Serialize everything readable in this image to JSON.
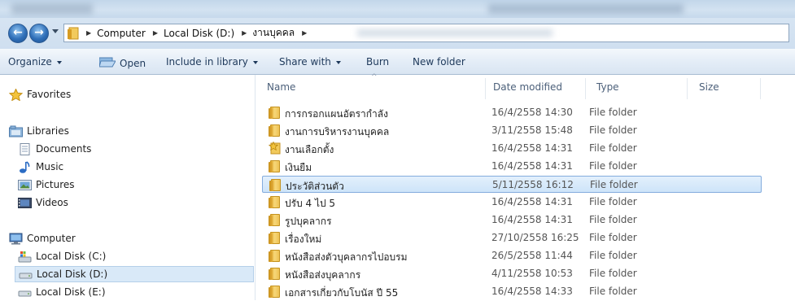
{
  "window": {
    "title": ""
  },
  "address": {
    "back_glyph": "←",
    "forward_glyph": "→",
    "separator": "▶",
    "segments": [
      "Computer",
      "Local Disk (D:)",
      "งานบุคคล"
    ]
  },
  "toolbar": {
    "organize": "Organize",
    "open": "Open",
    "include_in_library": "Include in library",
    "share_with": "Share with",
    "burn": "Burn",
    "new_folder": "New folder"
  },
  "nav": {
    "favorites": "Favorites",
    "libraries": "Libraries",
    "documents": "Documents",
    "music": "Music",
    "pictures": "Pictures",
    "videos": "Videos",
    "computer": "Computer",
    "disk_c": "Local Disk (C:)",
    "disk_d": "Local Disk (D:)",
    "disk_e": "Local Disk (E:)"
  },
  "columns": {
    "name": "Name",
    "date": "Date modified",
    "type": "Type",
    "size": "Size",
    "sort_indicator": "^"
  },
  "files": [
    {
      "name": "การกรอกแผนอัตรากำลัง",
      "date": "16/4/2558 14:30",
      "type": "File folder",
      "icon": "folder-icon"
    },
    {
      "name": "งานการบริหารงานบุคคล",
      "date": "3/11/2558 15:48",
      "type": "File folder",
      "icon": "folder-icon"
    },
    {
      "name": "งานเลือกตั้ง",
      "date": "16/4/2558 14:31",
      "type": "File folder",
      "icon": "favorite-folder-icon"
    },
    {
      "name": "เงินยืม",
      "date": "16/4/2558 14:31",
      "type": "File folder",
      "icon": "folder-icon"
    },
    {
      "name": "ประวัติส่วนตัว",
      "date": "5/11/2558 16:12",
      "type": "File folder",
      "icon": "folder-icon",
      "selected": true
    },
    {
      "name": "ปรับ 4 ไป 5",
      "date": "16/4/2558 14:31",
      "type": "File folder",
      "icon": "folder-icon"
    },
    {
      "name": "รูปบุคลากร",
      "date": "16/4/2558 14:31",
      "type": "File folder",
      "icon": "folder-icon"
    },
    {
      "name": "เรื่องใหม่",
      "date": "27/10/2558 16:25",
      "type": "File folder",
      "icon": "folder-icon"
    },
    {
      "name": "หนังสือส่งตัวบุคลากรไปอบรม",
      "date": "26/5/2558 11:44",
      "type": "File folder",
      "icon": "folder-icon"
    },
    {
      "name": "หนังสือส่งบุคลากร",
      "date": "4/11/2558 10:53",
      "type": "File folder",
      "icon": "folder-icon"
    },
    {
      "name": "เอกสารเกี่ยวกับโบนัส ปี 55",
      "date": "16/4/2558 14:33",
      "type": "File folder",
      "icon": "folder-icon"
    }
  ],
  "colors": {
    "selection_fill": "#cde4f9",
    "selection_border": "#84acdd",
    "toolbar_text": "#1e395b"
  }
}
